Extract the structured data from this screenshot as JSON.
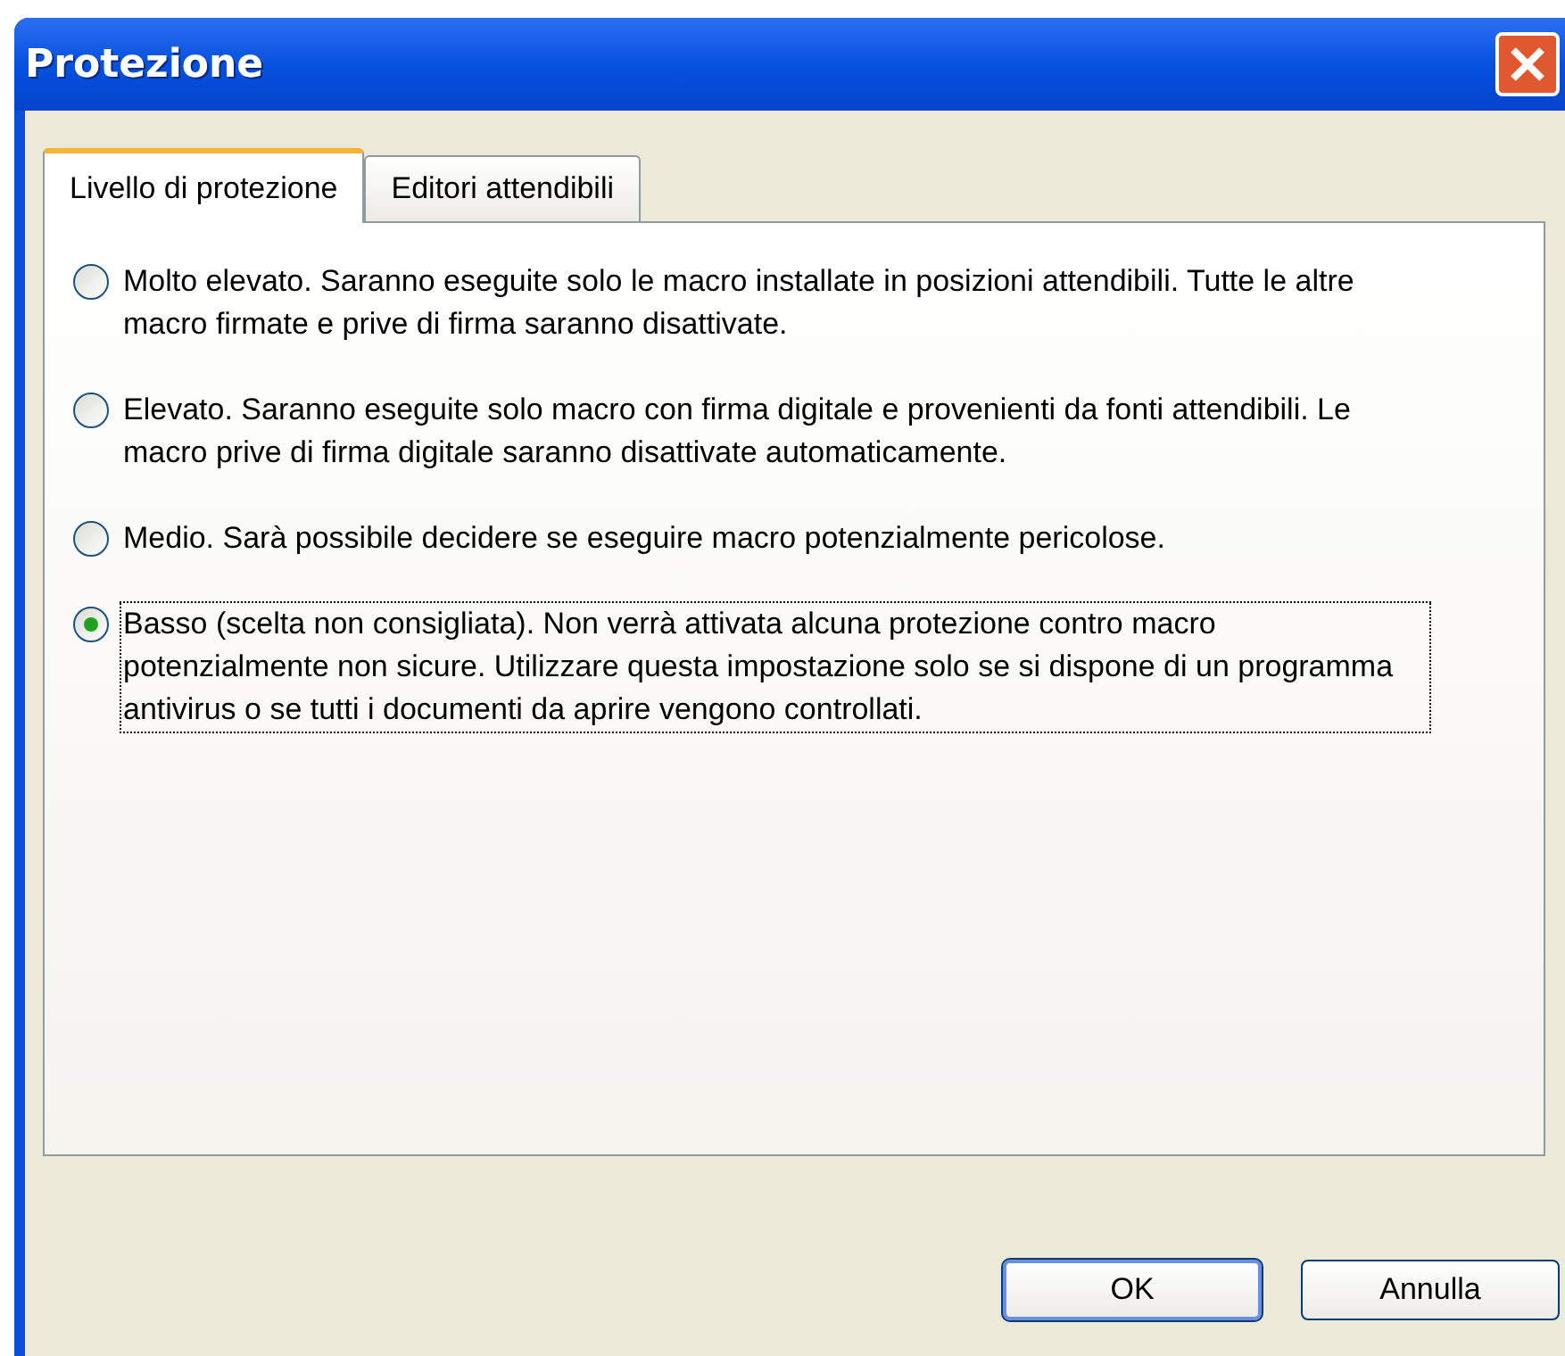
{
  "window": {
    "title": "Protezione"
  },
  "tabs": [
    {
      "label": "Livello di protezione",
      "selected": true
    },
    {
      "label": "Editori attendibili",
      "selected": false
    }
  ],
  "options": [
    {
      "label": "Molto elevato. Saranno eseguite solo le macro installate in posizioni attendibili. Tutte le altre macro firmate e prive di firma saranno disattivate.",
      "selected": false
    },
    {
      "label": "Elevato. Saranno eseguite solo macro con firma digitale e provenienti da fonti attendibili. Le macro prive di firma digitale saranno disattivate automaticamente.",
      "selected": false
    },
    {
      "label": "Medio. Sarà possibile decidere se eseguire macro potenzialmente pericolose.",
      "selected": false
    },
    {
      "label": "Basso (scelta non consigliata). Non verrà attivata alcuna protezione contro macro potenzialmente non sicure. Utilizzare questa impostazione solo se si dispone di un programma antivirus o se tutti i documenti da aprire vengono controllati.",
      "selected": true
    }
  ],
  "buttons": [
    {
      "label": "OK",
      "default": true
    },
    {
      "label": "Annulla",
      "default": false
    }
  ]
}
